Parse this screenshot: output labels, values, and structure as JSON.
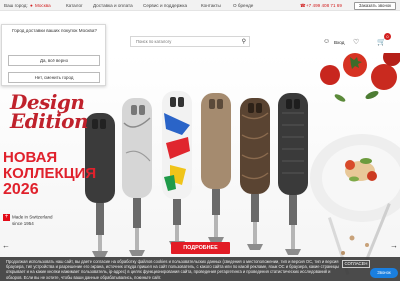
{
  "topbar": {
    "city_prefix": "Ваш город:",
    "city": "Москва",
    "menu": [
      "Каталог",
      "Доставка и оплата",
      "Сервис и поддержка",
      "Контакты",
      "О бренде"
    ],
    "phone": "+7 499 408 71 69",
    "callback": "Заказать звонок"
  },
  "header": {
    "search_placeholder": "Поиск по каталогу",
    "login": "Вход",
    "cart_count": "0"
  },
  "city_popup": {
    "question": "Город доставки ваших покупок Москва?",
    "confirm": "Да, всё верно",
    "change": "Нет, сменить город"
  },
  "hero": {
    "design_line1": "Design",
    "design_line2": "Edition",
    "new_line1": "НОВАЯ",
    "new_line2": "КОЛЛЕКЦИЯ",
    "year": "2026",
    "made_in": "Made in Switzerland",
    "since": "since 1954",
    "cta": "ПОДРОБНЕЕ",
    "accent": "#e21c25"
  },
  "cookie": {
    "text": "Продолжая использовать наш сайт, вы даете согласие на обработку файлов cookies и пользовательских данных (сведения о местоположении, тип и версия ОС, тип и версия браузера, тип устройства и разрешение его экрана, источник откуда пришел на сайт пользователь, с какого сайта или по какой рекламе, язык ОС и браузера, какие страницы открывает и на какие кнопки нажимает пользователь, ip-адрес) в целях функционирования сайта, проведения ретаргетинга и проведения статистических исследований и обзоров. Если вы не хотите, чтобы ваши данные обрабатывались, покиньте сайт.",
    "accept": "СОГЛАСЕН",
    "call": "Звонок"
  }
}
